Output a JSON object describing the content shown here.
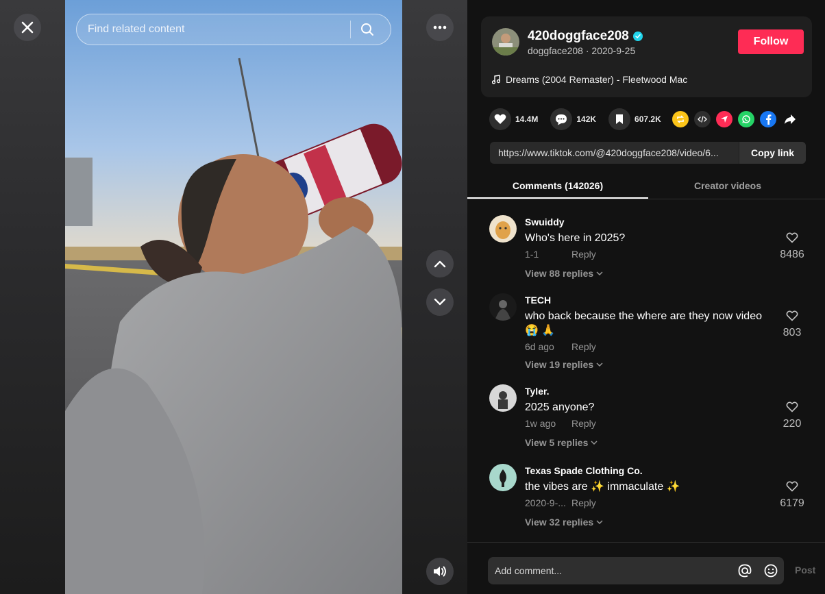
{
  "search": {
    "placeholder": "Find related content"
  },
  "creator": {
    "username": "420doggface208",
    "handle_date": "doggface208 · 2020-9-25",
    "follow_label": "Follow",
    "music": "Dreams (2004 Remaster) - Fleetwood Mac"
  },
  "stats": {
    "likes": "14.4M",
    "comments": "142K",
    "saves": "607.2K"
  },
  "share_icons": [
    "repost-icon",
    "embed-icon",
    "send-icon",
    "whatsapp-icon",
    "facebook-icon",
    "share-arrow-icon"
  ],
  "link": {
    "url": "https://www.tiktok.com/@420doggface208/video/6...",
    "copy_label": "Copy link"
  },
  "tabs": [
    {
      "label": "Comments (142026)",
      "active": true
    },
    {
      "label": "Creator videos",
      "active": false
    }
  ],
  "comments": [
    {
      "user": "Swuiddy",
      "text": "Who's here in 2025?",
      "time": "1-1",
      "reply": "Reply",
      "replies": "View 88 replies",
      "likes": "8486"
    },
    {
      "user": "TECH",
      "text": "who back because the where are they now video 😭 🙏",
      "time": "6d ago",
      "reply": "Reply",
      "replies": "View 19 replies",
      "likes": "803"
    },
    {
      "user": "Tyler.",
      "text": "2025 anyone?",
      "time": "1w ago",
      "reply": "Reply",
      "replies": "View 5 replies",
      "likes": "220"
    },
    {
      "user": "Texas Spade Clothing Co.",
      "text": "the vibes are ✨ immaculate ✨",
      "time": "2020-9-...",
      "reply": "Reply",
      "replies": "View 32 replies",
      "likes": "6179"
    }
  ],
  "comment_box": {
    "placeholder": "Add comment...",
    "post_label": "Post"
  },
  "colors": {
    "accent": "#fe2c55",
    "verified": "#20d5ec",
    "panel_bg": "#121212",
    "card_bg": "#1f1f1f"
  }
}
